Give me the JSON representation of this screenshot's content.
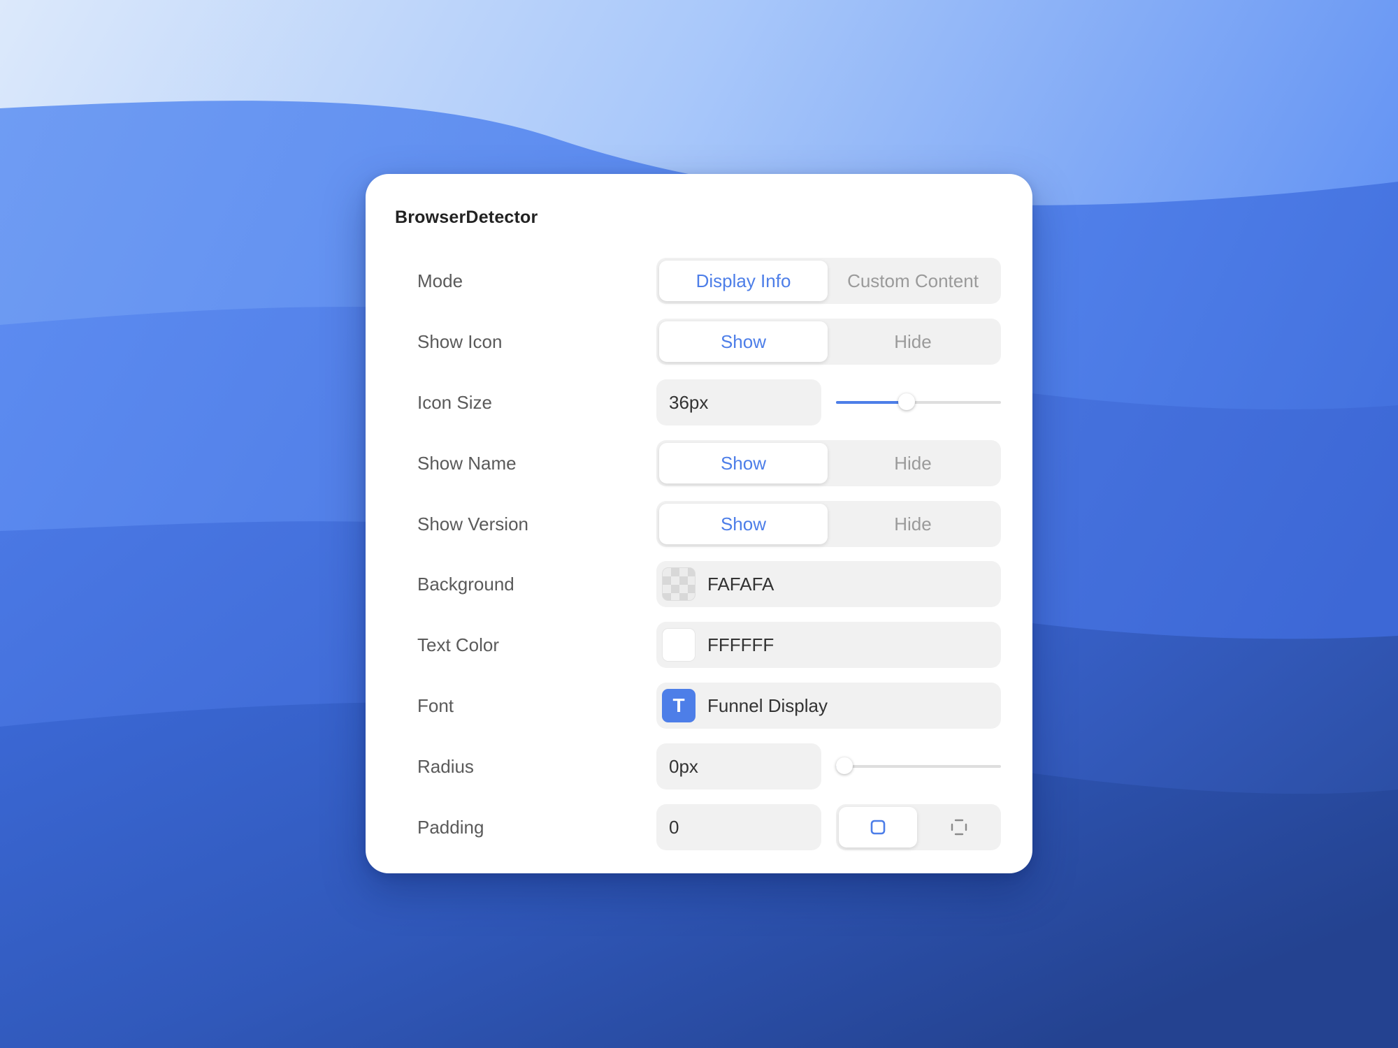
{
  "panel": {
    "title": "BrowserDetector"
  },
  "rows": {
    "mode": {
      "label": "Mode",
      "options": [
        "Display Info",
        "Custom Content"
      ],
      "selected": "Display Info"
    },
    "show_icon": {
      "label": "Show Icon",
      "options": [
        "Show",
        "Hide"
      ],
      "selected": "Show"
    },
    "icon_size": {
      "label": "Icon Size",
      "value": "36px",
      "slider_fraction": 0.42
    },
    "show_name": {
      "label": "Show Name",
      "options": [
        "Show",
        "Hide"
      ],
      "selected": "Show"
    },
    "show_version": {
      "label": "Show Version",
      "options": [
        "Show",
        "Hide"
      ],
      "selected": "Show"
    },
    "background": {
      "label": "Background",
      "value": "FAFAFA"
    },
    "text_color": {
      "label": "Text Color",
      "value": "FFFFFF"
    },
    "font": {
      "label": "Font",
      "value": "Funnel Display",
      "icon_glyph": "T"
    },
    "radius": {
      "label": "Radius",
      "value": "0px",
      "slider_fraction": 0.0
    },
    "padding": {
      "label": "Padding",
      "value": "0",
      "mode": "uniform"
    }
  },
  "icons": {
    "font": "text-t-icon",
    "padding_uniform": "square-icon",
    "padding_individual": "dashed-square-icon"
  },
  "colors": {
    "accent": "#4D7EE8",
    "panel_bg": "#FFFFFF",
    "control_bg": "#F1F1F1",
    "label_text": "#5A5A5A",
    "inactive_text": "#9A9A9A"
  }
}
